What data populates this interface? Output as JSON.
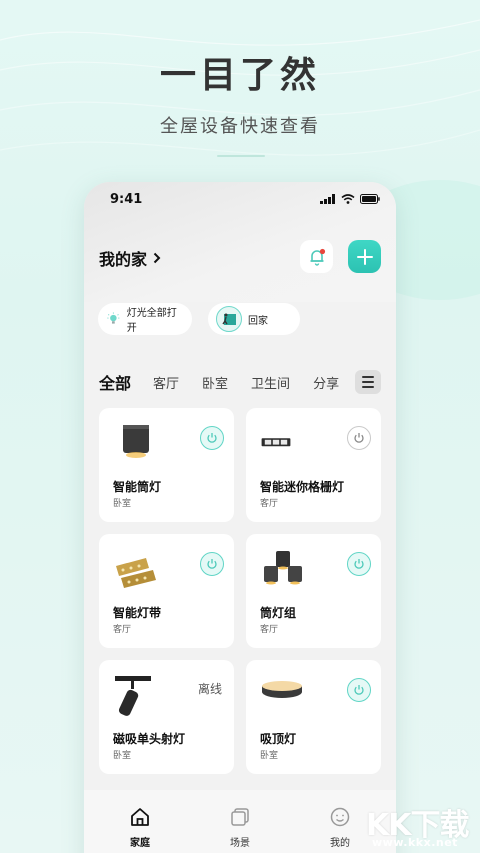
{
  "promo": {
    "title": "一目了然",
    "subtitle": "全屋设备快速查看"
  },
  "status_bar": {
    "time": "9:41"
  },
  "home": {
    "title": "我的家",
    "chevron": "chevron-right-icon"
  },
  "scenes": [
    {
      "label": "灯光全部打开",
      "icon": "bulb-icon"
    },
    {
      "label": "回家",
      "icon": "walk-home-icon"
    }
  ],
  "tabs": [
    "全部",
    "客厅",
    "卧室",
    "卫生间",
    "分享"
  ],
  "devices": [
    {
      "name": "智能筒灯",
      "room": "卧室",
      "state": "on"
    },
    {
      "name": "智能迷你格栅灯",
      "room": "客厅",
      "state": "off"
    },
    {
      "name": "智能灯带",
      "room": "客厅",
      "state": "on"
    },
    {
      "name": "筒灯组",
      "room": "客厅",
      "state": "on"
    },
    {
      "name": "磁吸单头射灯",
      "room": "卧室",
      "state": "offline",
      "status_label": "离线"
    },
    {
      "name": "吸顶灯",
      "room": "卧室",
      "state": "on"
    }
  ],
  "bottom_nav": [
    {
      "label": "家庭",
      "icon": "home-icon",
      "active": true
    },
    {
      "label": "场景",
      "icon": "scene-icon",
      "active": false
    },
    {
      "label": "我的",
      "icon": "profile-icon",
      "active": false
    }
  ],
  "watermark": {
    "logo": "KK下载",
    "url": "www.kkx.net"
  },
  "colors": {
    "accent": "#2cc2b2",
    "background": "#e4f8f4"
  }
}
